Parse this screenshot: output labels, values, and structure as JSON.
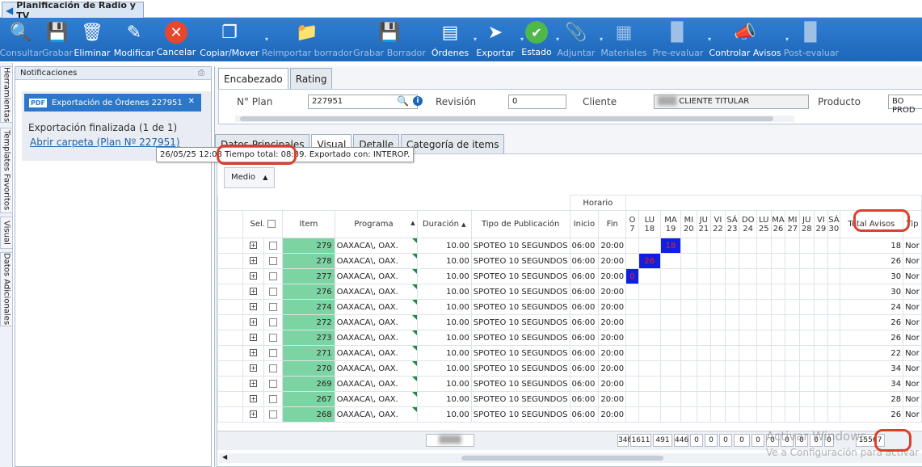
{
  "window": {
    "title": "Planificación de Radio y TV"
  },
  "ribbon": [
    {
      "label": "Consultar",
      "icon": "search-icon",
      "enabled": false
    },
    {
      "label": "Grabar",
      "icon": "save-icon",
      "enabled": false
    },
    {
      "label": "Eliminar",
      "icon": "delete-icon",
      "enabled": true
    },
    {
      "label": "Modificar",
      "icon": "edit-icon",
      "enabled": true
    },
    {
      "label": "Cancelar",
      "icon": "cancel-icon",
      "enabled": true
    },
    {
      "label": "Copiar/Mover",
      "icon": "copy-icon",
      "enabled": true
    },
    {
      "label": "Reimportar borrador",
      "icon": "folder-icon",
      "enabled": false
    },
    {
      "label": "Grabar Borrador",
      "icon": "save-draft-icon",
      "enabled": false
    },
    {
      "label": "Órdenes",
      "icon": "orders-icon",
      "enabled": true
    },
    {
      "label": "Exportar",
      "icon": "export-icon",
      "enabled": true
    },
    {
      "label": "Estado",
      "icon": "status-icon",
      "enabled": true
    },
    {
      "label": "Adjuntar",
      "icon": "attach-icon",
      "enabled": false
    },
    {
      "label": "Materiales",
      "icon": "materials-icon",
      "enabled": false
    },
    {
      "label": "Pre-evaluar",
      "icon": "pre-evaluate-icon",
      "enabled": false
    },
    {
      "label": "Controlar Avisos",
      "icon": "control-ads-icon",
      "enabled": true
    },
    {
      "label": "Post-evaluar",
      "icon": "post-evaluate-icon",
      "enabled": false
    }
  ],
  "side_tabs": [
    "Herramientas",
    "Templates Favoritos",
    "Visual",
    "Datos Adicionales"
  ],
  "notifications": {
    "header": "Notificaciones",
    "card_title": "Exportación de Órdenes 227951",
    "status": "Exportación finalizada (1 de 1)",
    "link": "Abrir carpeta (Plan Nº 227951)"
  },
  "tooltip": {
    "date": "26/05/25 12:08",
    "total": "Tiempo total: 08:39.",
    "exported": "Exportado con: INTEROP."
  },
  "main_tabs": [
    "Encabezado",
    "Rating"
  ],
  "header_fields": {
    "plan_label": "N° Plan",
    "plan_value": "227951",
    "revision_label": "Revisión",
    "revision_value": "0",
    "client_label": "Cliente",
    "client_value": "CLIENTE TITULAR",
    "product_label": "Producto",
    "product_value": "BO PROD"
  },
  "sub_tabs": [
    "Datos Principales",
    "Visual",
    "Detalle",
    "Categoría de items"
  ],
  "grid": {
    "medio_label": "Medio",
    "horario_label": "Horario",
    "columns": {
      "sel": "Sel.",
      "item": "Item",
      "programa": "Programa",
      "duracion": "Duración",
      "tipo": "Tipo de Publicación",
      "inicio": "Inicio",
      "fin": "Fin",
      "total": "Total Avisos",
      "tipo2": "Tip"
    },
    "day_headers": [
      {
        "d": "O",
        "n": "7"
      },
      {
        "d": "LU",
        "n": "18"
      },
      {
        "d": "MA",
        "n": "19"
      },
      {
        "d": "MI",
        "n": "20"
      },
      {
        "d": "JU",
        "n": "21"
      },
      {
        "d": "VI",
        "n": "22"
      },
      {
        "d": "SÁ",
        "n": "23"
      },
      {
        "d": "DO",
        "n": "24"
      },
      {
        "d": "LU",
        "n": "25"
      },
      {
        "d": "MA",
        "n": "26"
      },
      {
        "d": "MI",
        "n": "27"
      },
      {
        "d": "JU",
        "n": "28"
      },
      {
        "d": "VI",
        "n": "29"
      },
      {
        "d": "SÁ",
        "n": "30"
      }
    ],
    "rows": [
      {
        "item": "279",
        "programa": "OAXACA\\, OAX.",
        "duracion": "10.00",
        "tipo": "SPOTEO 10 SEGUNDOS",
        "inicio": "06:00",
        "fin": "20:00",
        "total": "18",
        "tipo2": "Nor",
        "mark_col": 2,
        "mark_val": "18"
      },
      {
        "item": "278",
        "programa": "OAXACA\\, OAX.",
        "duracion": "10.00",
        "tipo": "SPOTEO 10 SEGUNDOS",
        "inicio": "06:00",
        "fin": "20:00",
        "total": "26",
        "tipo2": "Nor",
        "mark_col": 1,
        "mark_val": "26"
      },
      {
        "item": "277",
        "programa": "OAXACA\\, OAX.",
        "duracion": "10.00",
        "tipo": "SPOTEO 10 SEGUNDOS",
        "inicio": "06:00",
        "fin": "20:00",
        "total": "30",
        "tipo2": "Nor",
        "mark_col": 0,
        "mark_val": "0"
      },
      {
        "item": "276",
        "programa": "OAXACA\\, OAX.",
        "duracion": "10.00",
        "tipo": "SPOTEO 10 SEGUNDOS",
        "inicio": "06:00",
        "fin": "20:00",
        "total": "30",
        "tipo2": "Nor",
        "mark_col": -1,
        "mark_val": ""
      },
      {
        "item": "274",
        "programa": "OAXACA\\, OAX.",
        "duracion": "10.00",
        "tipo": "SPOTEO 10 SEGUNDOS",
        "inicio": "06:00",
        "fin": "20:00",
        "total": "24",
        "tipo2": "Nor",
        "mark_col": -1,
        "mark_val": ""
      },
      {
        "item": "272",
        "programa": "OAXACA\\, OAX.",
        "duracion": "10.00",
        "tipo": "SPOTEO 10 SEGUNDOS",
        "inicio": "06:00",
        "fin": "20:00",
        "total": "26",
        "tipo2": "Nor",
        "mark_col": -1,
        "mark_val": ""
      },
      {
        "item": "273",
        "programa": "OAXACA\\, OAX.",
        "duracion": "10.00",
        "tipo": "SPOTEO 10 SEGUNDOS",
        "inicio": "06:00",
        "fin": "20:00",
        "total": "26",
        "tipo2": "Nor",
        "mark_col": -1,
        "mark_val": ""
      },
      {
        "item": "271",
        "programa": "OAXACA\\, OAX.",
        "duracion": "10.00",
        "tipo": "SPOTEO 10 SEGUNDOS",
        "inicio": "06:00",
        "fin": "20:00",
        "total": "22",
        "tipo2": "Nor",
        "mark_col": -1,
        "mark_val": ""
      },
      {
        "item": "270",
        "programa": "OAXACA\\, OAX.",
        "duracion": "10.00",
        "tipo": "SPOTEO 10 SEGUNDOS",
        "inicio": "06:00",
        "fin": "20:00",
        "total": "34",
        "tipo2": "Nor",
        "mark_col": -1,
        "mark_val": ""
      },
      {
        "item": "269",
        "programa": "OAXACA\\, OAX.",
        "duracion": "10.00",
        "tipo": "SPOTEO 10 SEGUNDOS",
        "inicio": "06:00",
        "fin": "20:00",
        "total": "34",
        "tipo2": "Nor",
        "mark_col": -1,
        "mark_val": ""
      },
      {
        "item": "267",
        "programa": "OAXACA\\, OAX.",
        "duracion": "10.00",
        "tipo": "SPOTEO 10 SEGUNDOS",
        "inicio": "06:00",
        "fin": "20:00",
        "total": "28",
        "tipo2": "Nor",
        "mark_col": -1,
        "mark_val": ""
      },
      {
        "item": "268",
        "programa": "OAXACA\\, OAX.",
        "duracion": "10.00",
        "tipo": "SPOTEO 10 SEGUNDOS",
        "inicio": "06:00",
        "fin": "20:00",
        "total": "26",
        "tipo2": "Nor",
        "mark_col": -1,
        "mark_val": ""
      }
    ],
    "footer_values": [
      "346",
      "1611",
      "491",
      "446",
      "0",
      "0",
      "0",
      "0",
      "0",
      "0",
      "0",
      "0",
      "0",
      "0"
    ],
    "footer_total": "15567"
  },
  "watermark": {
    "line1": "Activar Windows",
    "line2": "Ve a Configuración para activar"
  },
  "colors": {
    "ribbon": "#1e66b8",
    "item_cell": "#7dd4a3",
    "mark": "#1020e0",
    "highlight": "#d9412a"
  }
}
